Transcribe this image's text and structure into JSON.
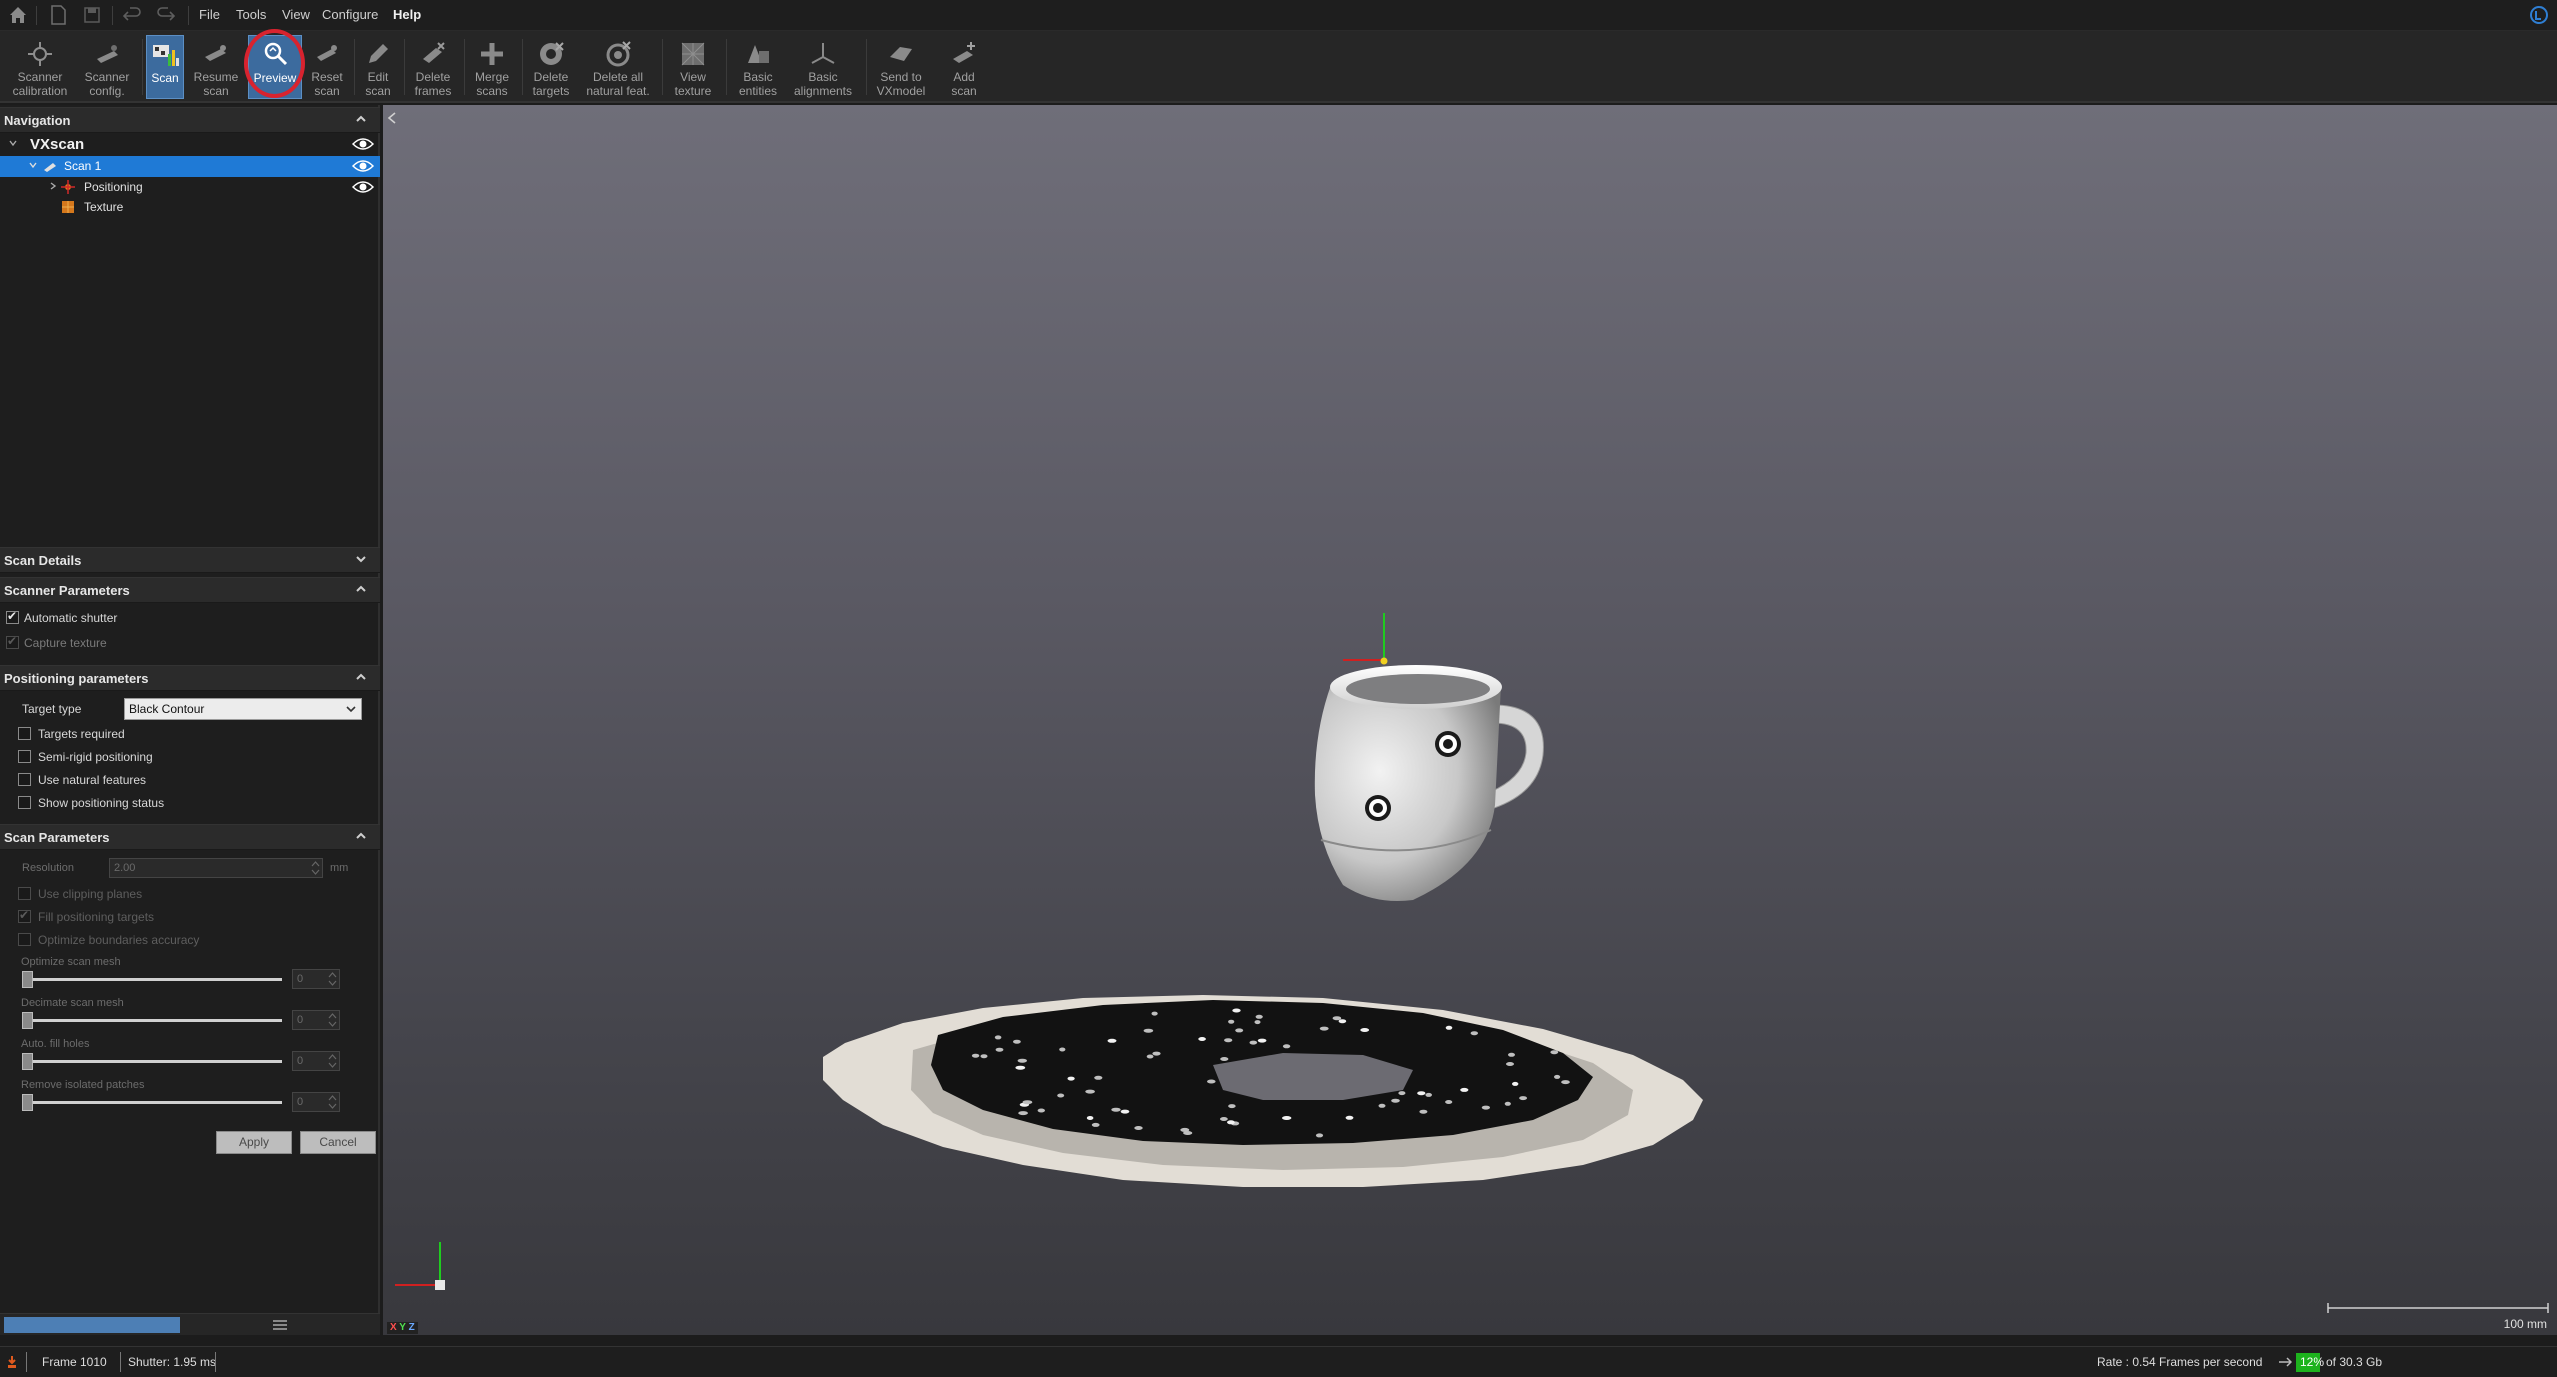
{
  "menubar": {
    "items": [
      "File",
      "Tools",
      "View",
      "Configure",
      "Help"
    ]
  },
  "toolbar": {
    "buttons": [
      {
        "label": "Scanner\ncalibration",
        "icon": "scanner-calibration-icon"
      },
      {
        "label": "Scanner\nconfig.",
        "icon": "scanner-config-icon"
      },
      {
        "label": "Scan",
        "icon": "scan-icon"
      },
      {
        "label": "Resume\nscan",
        "icon": "resume-scan-icon"
      },
      {
        "label": "Preview",
        "icon": "preview-icon"
      },
      {
        "label": "Reset\nscan",
        "icon": "reset-scan-icon"
      },
      {
        "label": "Edit\nscan",
        "icon": "edit-scan-icon"
      },
      {
        "label": "Delete\nframes",
        "icon": "delete-frames-icon"
      },
      {
        "label": "Merge\nscans",
        "icon": "merge-scans-icon"
      },
      {
        "label": "Delete\ntargets",
        "icon": "delete-targets-icon"
      },
      {
        "label": "Delete all\nnatural feat.",
        "icon": "delete-natural-features-icon"
      },
      {
        "label": "View\ntexture",
        "icon": "view-texture-icon"
      },
      {
        "label": "Basic\nentities",
        "icon": "basic-entities-icon"
      },
      {
        "label": "Basic\nalignments",
        "icon": "basic-alignments-icon"
      },
      {
        "label": "Send to\nVXmodel",
        "icon": "send-to-vxmodel-icon"
      },
      {
        "label": "Add\nscan",
        "icon": "add-scan-icon"
      }
    ]
  },
  "navigation": {
    "title": "Navigation",
    "root": "VXscan",
    "scan": "Scan 1",
    "children": [
      "Positioning",
      "Texture"
    ]
  },
  "scan_details": {
    "title": "Scan Details"
  },
  "scanner_parameters": {
    "title": "Scanner Parameters",
    "automatic_shutter": {
      "label": "Automatic shutter",
      "checked": true
    },
    "capture_texture": {
      "label": "Capture texture",
      "checked": true
    }
  },
  "positioning_parameters": {
    "title": "Positioning parameters",
    "target_type_label": "Target type",
    "target_type_value": "Black Contour",
    "targets_required": "Targets required",
    "semi_rigid": "Semi-rigid positioning",
    "natural_features": "Use natural features",
    "show_status": "Show positioning status"
  },
  "scan_parameters": {
    "title": "Scan Parameters",
    "resolution_label": "Resolution",
    "resolution_value": "2.00",
    "resolution_unit": "mm",
    "clipping_planes": "Use clipping planes",
    "fill_targets": "Fill positioning targets",
    "optimize_boundaries": "Optimize boundaries accuracy",
    "optimize_mesh": {
      "label": "Optimize scan mesh",
      "value": "0"
    },
    "decimate_mesh": {
      "label": "Decimate scan mesh",
      "value": "0"
    },
    "fill_holes": {
      "label": "Auto. fill holes",
      "value": "0"
    },
    "remove_patches": {
      "label": "Remove isolated patches",
      "value": "0"
    },
    "apply": "Apply",
    "cancel": "Cancel"
  },
  "viewport": {
    "axis_labels": [
      "X",
      "Y",
      "Z"
    ],
    "scale_label": "100 mm"
  },
  "status": {
    "frame": "Frame 1010",
    "shutter": "Shutter: 1.95 ms",
    "rate": "Rate : 0.54 Frames per second",
    "memory_percent": "12%",
    "memory_total": "of 30.3 Gb"
  },
  "colors": {
    "active_button": "#3c6b9e",
    "selection": "#1f7ad6",
    "highlight_ring": "#d8232f",
    "memory_bar": "#1db31d"
  }
}
